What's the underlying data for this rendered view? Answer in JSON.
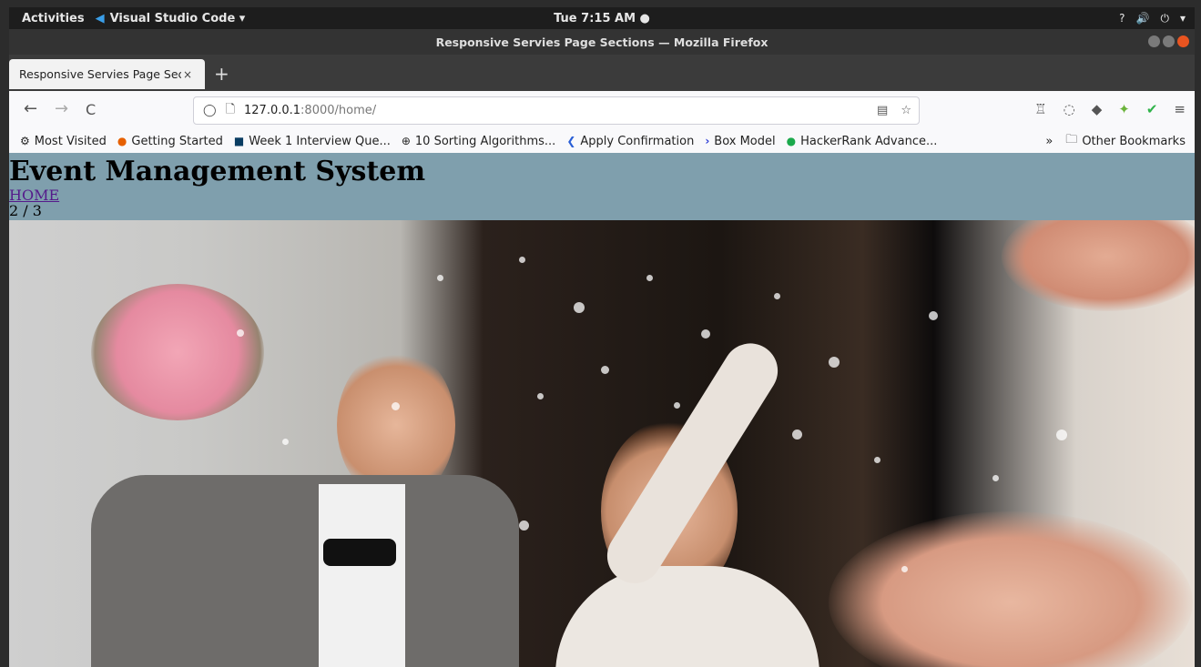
{
  "system_bar": {
    "activities": "Activities",
    "app_name": "Visual Studio Code ▾",
    "clock": "Tue  7:15 AM ●",
    "tray": [
      "?",
      "🔊",
      "⏻",
      "▾"
    ]
  },
  "window": {
    "title": "Responsive Servies Page Sections — Mozilla Firefox"
  },
  "tab": {
    "label": "Responsive Servies Page Sec",
    "close": "×",
    "new_tab": "+"
  },
  "nav": {
    "back": "←",
    "forward": "→",
    "reload": "C",
    "url_host": "127.0.0.1",
    "url_rest": ":8000/home/"
  },
  "bookmarks": [
    {
      "icon": "⚙",
      "label": "Most Visited"
    },
    {
      "icon": "●",
      "label": "Getting Started"
    },
    {
      "icon": "■",
      "label": "Week 1 Interview Que..."
    },
    {
      "icon": "⊕",
      "label": "10 Sorting Algorithms..."
    },
    {
      "icon": "❮",
      "label": "Apply Confirmation"
    },
    {
      "icon": "›",
      "label": "Box Model"
    },
    {
      "icon": "●",
      "label": "HackerRank Advance..."
    }
  ],
  "bookmarks_overflow": "»",
  "other_bookmarks": "Other Bookmarks",
  "page": {
    "title": "Event Management System",
    "nav_link": "HOME",
    "slide_counter": "2 / 3"
  }
}
